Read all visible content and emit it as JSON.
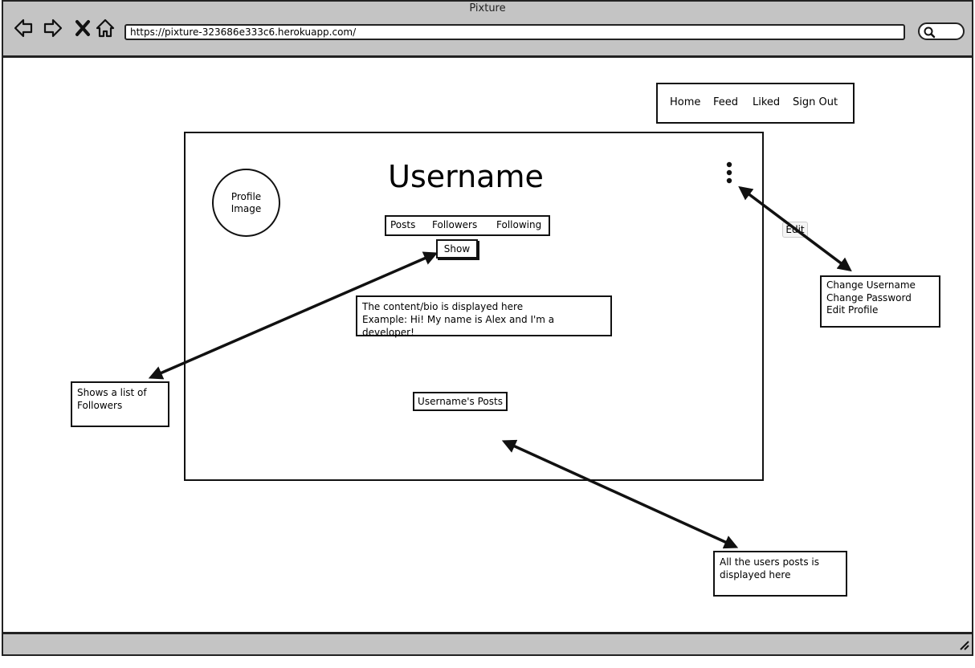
{
  "window": {
    "title": "Pixture"
  },
  "browser": {
    "url": "https://pixture-323686e333c6.herokuapp.com/",
    "icons": [
      "back-icon",
      "forward-icon",
      "close-icon",
      "home-icon",
      "search-icon",
      "resize-grip-icon"
    ]
  },
  "nav": {
    "items": [
      {
        "label": "Home"
      },
      {
        "label": "Feed"
      },
      {
        "label": "Liked"
      },
      {
        "label": "Sign Out"
      }
    ]
  },
  "profile": {
    "image_label": "Profile Image",
    "username": "Username",
    "stats": [
      {
        "label": "Posts"
      },
      {
        "label": "Followers"
      },
      {
        "label": "Following"
      }
    ],
    "show_label": "Show",
    "bio_line1": "The content/bio is displayed here",
    "bio_line2": "Example: Hi! My name is Alex and I'm a developer!",
    "posts_label": "Username's Posts",
    "menu_icon": "kebab-menu-icon"
  },
  "annotations": {
    "edit_tag": "Edit",
    "edit_menu": [
      "Change Username",
      "Change Password",
      "Edit Profile"
    ],
    "followers_note_line1": "Shows a list of",
    "followers_note_line2": "Followers",
    "posts_note_line1": "All the users posts is",
    "posts_note_line2": "displayed here"
  }
}
